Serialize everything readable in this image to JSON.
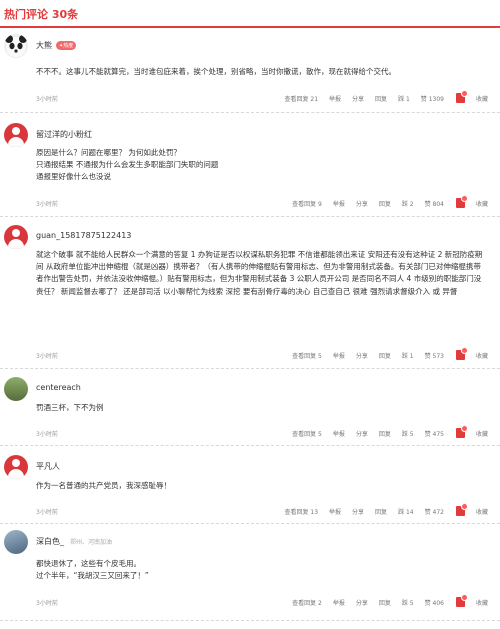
{
  "section_title": "热门评论 30条",
  "comments": [
    {
      "user": "大熊",
      "badge": "✦热度",
      "text": [
        "不不不。这事儿不能就算完，当时谁包庇来着，挨个处理，别省略，当时你撒谎，散作，现在就得给个交代。"
      ],
      "time": "3小时前",
      "replies": "查看回复 21",
      "report": "举报",
      "share": "分享",
      "reply": "回复",
      "up": "踩 1",
      "likes": "赞 1309",
      "collect": "收藏"
    },
    {
      "user": "留过洋的小粉红",
      "text": [
        "原因是什么？问题在哪里？ 为何如此处罚？",
        "只通报结果 不通报为什么会发生多职能部门失职的问题",
        "通报里好像什么也没说"
      ],
      "time": "3小时前",
      "replies": "查看回复 9",
      "report": "举报",
      "share": "分享",
      "reply": "回复",
      "up": "踩 2",
      "likes": "赞 804",
      "collect": "收藏"
    },
    {
      "user": "guan_15817875122413",
      "text": [
        "就这个破事 就不能给人民群众一个满意的答复 1 办狗证是否以权谋私职务犯罪 不信谁都能领出来证 安阳还有没有这种证 2 新冠防疫期间 从政府单位能冲出伸缩棍（就是凶器）携带者？（有人携带的伸缩棍贴有警用标志、但为非警用制式装备。有关部门已对伸缩棍携带者作出警告处罚，并依法没收伸缩棍。）贴有警用标志，但为非警用制式装备 3 公职人员开公司 是否同名不同人 4 市级别的职能部门没责任？ 新闻监督去哪了？ 还是部司活 以小聊帮忙为线索 深挖 要有刮骨疗毒的决心 自己查自己 很难 强烈请求督级介入 或 异督"
      ],
      "time": "3小时前",
      "replies": "查看回复 5",
      "report": "举报",
      "share": "分享",
      "reply": "回复",
      "up": "踩 1",
      "likes": "赞 573",
      "collect": "收藏"
    },
    {
      "user": "centereach",
      "text": [
        "罚酒三杯，下不为例"
      ],
      "time": "3小时前",
      "replies": "查看回复 5",
      "report": "举报",
      "share": "分享",
      "reply": "回复",
      "up": "踩 5",
      "likes": "赞 475",
      "collect": "收藏"
    },
    {
      "user": "平凡人",
      "text": [
        "作为一名普通的共产党员，我深感耻辱！"
      ],
      "time": "3小时前",
      "replies": "查看回复 13",
      "report": "举报",
      "share": "分享",
      "reply": "回复",
      "up": "踩 14",
      "likes": "赞 472",
      "collect": "收藏"
    },
    {
      "user": "深白色_",
      "location": "郑州、河南加油",
      "text": [
        "都快退休了，这些有个皮毛用。",
        "过个半年，“我胡汉三又回来了！”"
      ],
      "time": "3小时前",
      "replies": "查看回复 2",
      "report": "举报",
      "share": "分享",
      "reply": "回复",
      "up": "踩 5",
      "likes": "赞 406",
      "collect": "收藏"
    }
  ]
}
